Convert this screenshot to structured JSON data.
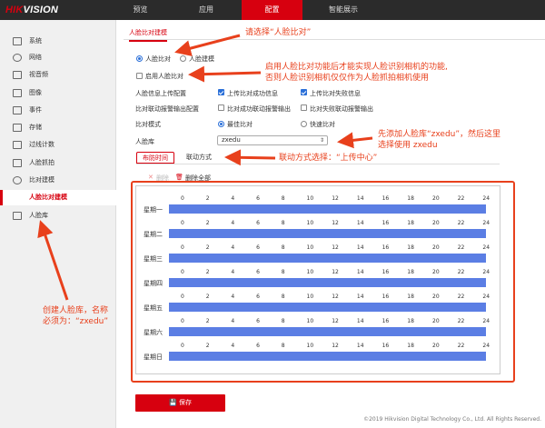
{
  "logo": "HIKVISION",
  "nav": [
    "预览",
    "应用",
    "配置",
    "智能展示"
  ],
  "sidebar": [
    "系统",
    "网络",
    "视音频",
    "图像",
    "事件",
    "存储",
    "过线计数",
    "人脸抓拍",
    "比对建模",
    "人脸比对建模",
    "人脸库"
  ],
  "tab": "人脸比对建模",
  "mode_options": [
    "人脸比对",
    "人脸建模"
  ],
  "enable_label": "启用人脸比对",
  "upload_label": "人脸信息上传配置",
  "upload_options": [
    "上传比对成功信息",
    "上传比对失败信息"
  ],
  "linkage_label": "比对联动报警输出配置",
  "linkage_options": [
    "比对成功联动报警输出",
    "比对失败联动报警输出"
  ],
  "compare_label": "比对模式",
  "compare_options": [
    "最佳比对",
    "快速比对"
  ],
  "library_label": "人脸库",
  "library_value": "zxedu",
  "subtabs": [
    "布防时间",
    "联动方式"
  ],
  "delete_label": "删除",
  "delete_all_label": "删除全部",
  "hours": [
    "0",
    "2",
    "4",
    "6",
    "8",
    "10",
    "12",
    "14",
    "16",
    "18",
    "20",
    "22",
    "24"
  ],
  "days": [
    "星期一",
    "星期二",
    "星期三",
    "星期四",
    "星期五",
    "星期六",
    "星期日"
  ],
  "save_label": "保存",
  "footer": "©2019 Hikvision Digital Technology Co., Ltd. All Rights Reserved.",
  "notes": {
    "n1": "请选择“人脸比对”",
    "n2a": "启用人脸比对功能后才能实现人脸识别相机的功能,",
    "n2b": "否则人脸识别相机仅仅作为人脸抓拍相机使用",
    "n3a": "先添加人脸库“zxedu”，然后这里",
    "n3b": "选择使用 zxedu",
    "n4": "联动方式选择：“上传中心”",
    "n5a": "创建人脸库，名称",
    "n5b": "必须为：“zxedu”"
  },
  "colors": {
    "brand": "#d7000f",
    "annotation": "#e8401c",
    "schedule": "#5b7ee4",
    "accent": "#2a6fd8"
  }
}
